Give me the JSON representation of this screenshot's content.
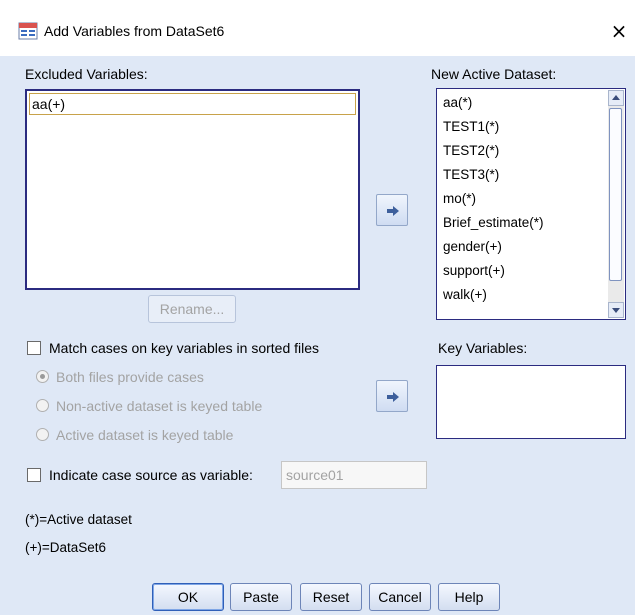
{
  "window": {
    "title": "Add Variables from DataSet6",
    "close_glyph": "×",
    "app_icon": "spss-merge-icon"
  },
  "excluded": {
    "label": "Excluded Variables:",
    "items": [
      "aa(+)"
    ]
  },
  "new_active": {
    "label": "New Active Dataset:",
    "items": [
      "aa(*)",
      "TEST1(*)",
      "TEST2(*)",
      "TEST3(*)",
      "mo(*)",
      "Brief_estimate(*)",
      "gender(+)",
      "support(+)",
      "walk(+)"
    ]
  },
  "rename_button": "Rename...",
  "match_cases": {
    "label": "Match cases on key variables in sorted files",
    "checked": false,
    "options": [
      {
        "label": "Both files provide cases",
        "selected": true
      },
      {
        "label": "Non-active dataset is keyed table",
        "selected": false
      },
      {
        "label": "Active dataset is keyed table",
        "selected": false
      }
    ]
  },
  "key_variables": {
    "label": "Key Variables:",
    "items": []
  },
  "indicate_source": {
    "label": "Indicate case source as variable:",
    "checked": false,
    "value": "source01"
  },
  "legend": {
    "active": "(*)=Active dataset",
    "dataset6": "(+)=DataSet6"
  },
  "buttons": {
    "ok": "OK",
    "paste": "Paste",
    "reset": "Reset",
    "cancel": "Cancel",
    "help": "Help"
  },
  "colors": {
    "dialog_bg": "#dfe8f6",
    "list_border": "#2b2b80",
    "disabled_text": "#a3a3a3"
  }
}
